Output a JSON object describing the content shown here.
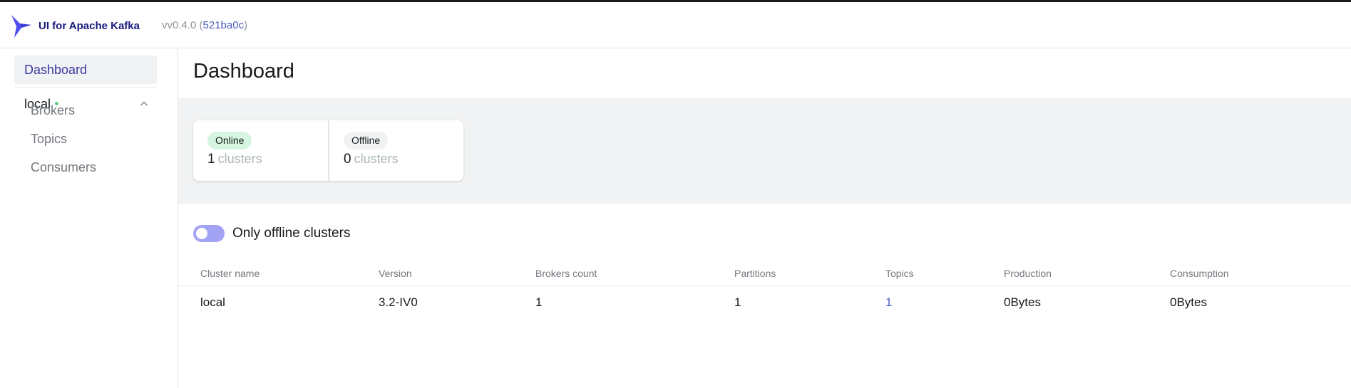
{
  "header": {
    "app_title": "UI for Apache Kafka",
    "version_prefix": "vv0.4.0 (",
    "commit": "521ba0c",
    "version_suffix": ")"
  },
  "sidebar": {
    "dashboard_label": "Dashboard",
    "cluster": {
      "name": "local",
      "status": "online",
      "items": [
        {
          "label": "Brokers"
        },
        {
          "label": "Topics"
        },
        {
          "label": "Consumers"
        }
      ]
    }
  },
  "main": {
    "title": "Dashboard",
    "metrics": {
      "online": {
        "badge": "Online",
        "value": "1",
        "unit": "clusters"
      },
      "offline": {
        "badge": "Offline",
        "value": "0",
        "unit": "clusters"
      }
    },
    "toggle": {
      "label": "Only offline clusters",
      "checked": false
    },
    "table": {
      "columns": [
        "Cluster name",
        "Version",
        "Brokers count",
        "Partitions",
        "Topics",
        "Production",
        "Consumption"
      ],
      "rows": [
        {
          "cluster_name": "local",
          "version": "3.2-IV0",
          "brokers_count": "1",
          "partitions": "1",
          "topics": "1",
          "production": "0Bytes",
          "consumption": "0Bytes"
        }
      ]
    }
  },
  "colors": {
    "accent": "#4c5db8",
    "online_badge": "#d6f5e0",
    "online_dot": "#5cd685",
    "toggle": "#a3a3f5"
  }
}
